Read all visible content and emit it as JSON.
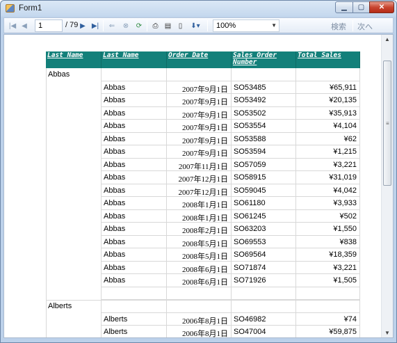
{
  "window": {
    "title": "Form1"
  },
  "toolbar": {
    "current_page": "1",
    "total_pages_text": "/ 79",
    "zoom": "100%",
    "find_label": "検索",
    "next_label": "次へ"
  },
  "report": {
    "headers": [
      "Last Name",
      "Last Name",
      "Order Date",
      "Sales Order Number",
      "Total Sales"
    ],
    "groups": [
      {
        "name": "Abbas",
        "rows": [
          {
            "last_name": "Abbas",
            "date": "2007年9月1日",
            "order": "SO53485",
            "total": "¥65,911"
          },
          {
            "last_name": "Abbas",
            "date": "2007年9月1日",
            "order": "SO53492",
            "total": "¥20,135"
          },
          {
            "last_name": "Abbas",
            "date": "2007年9月1日",
            "order": "SO53502",
            "total": "¥35,913"
          },
          {
            "last_name": "Abbas",
            "date": "2007年9月1日",
            "order": "SO53554",
            "total": "¥4,104"
          },
          {
            "last_name": "Abbas",
            "date": "2007年9月1日",
            "order": "SO53588",
            "total": "¥62"
          },
          {
            "last_name": "Abbas",
            "date": "2007年9月1日",
            "order": "SO53594",
            "total": "¥1,215"
          },
          {
            "last_name": "Abbas",
            "date": "2007年11月1日",
            "order": "SO57059",
            "total": "¥3,221"
          },
          {
            "last_name": "Abbas",
            "date": "2007年12月1日",
            "order": "SO58915",
            "total": "¥31,019"
          },
          {
            "last_name": "Abbas",
            "date": "2007年12月1日",
            "order": "SO59045",
            "total": "¥4,042"
          },
          {
            "last_name": "Abbas",
            "date": "2008年1月1日",
            "order": "SO61180",
            "total": "¥3,933"
          },
          {
            "last_name": "Abbas",
            "date": "2008年1月1日",
            "order": "SO61245",
            "total": "¥502"
          },
          {
            "last_name": "Abbas",
            "date": "2008年2月1日",
            "order": "SO63203",
            "total": "¥1,550"
          },
          {
            "last_name": "Abbas",
            "date": "2008年5月1日",
            "order": "SO69553",
            "total": "¥838"
          },
          {
            "last_name": "Abbas",
            "date": "2008年5月1日",
            "order": "SO69564",
            "total": "¥18,359"
          },
          {
            "last_name": "Abbas",
            "date": "2008年6月1日",
            "order": "SO71874",
            "total": "¥3,221"
          },
          {
            "last_name": "Abbas",
            "date": "2008年6月1日",
            "order": "SO71926",
            "total": "¥1,505"
          }
        ]
      },
      {
        "name": "Alberts",
        "rows": [
          {
            "last_name": "Alberts",
            "date": "2006年8月1日",
            "order": "SO46982",
            "total": "¥74"
          },
          {
            "last_name": "Alberts",
            "date": "2006年8月1日",
            "order": "SO47004",
            "total": "¥59,875"
          }
        ]
      }
    ]
  }
}
